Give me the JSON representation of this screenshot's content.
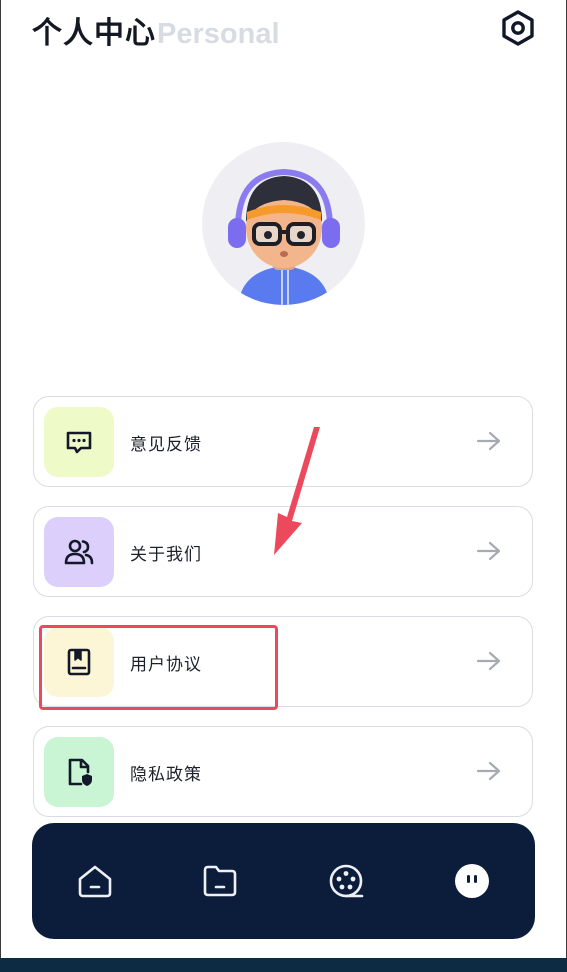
{
  "header": {
    "title": "个人中心",
    "subtitle": "Personal",
    "settings_icon": "gear-hex-icon"
  },
  "avatar": {
    "icon": "3d-character-headphones-avatar"
  },
  "menu": [
    {
      "label": "意见反馈",
      "icon": "message-dots-icon",
      "color": "#eefbc8"
    },
    {
      "label": "关于我们",
      "icon": "users-icon",
      "color": "#dccffb"
    },
    {
      "label": "用户协议",
      "icon": "document-bookmark-icon",
      "color": "#fdf6d6"
    },
    {
      "label": "隐私政策",
      "icon": "file-shield-icon",
      "color": "#c9f5d4"
    }
  ],
  "annotations": {
    "highlight_color": "#ec4a5c"
  },
  "tabbar": {
    "background": "#0c1d3b",
    "items": [
      {
        "icon": "home-icon"
      },
      {
        "icon": "folder-icon"
      },
      {
        "icon": "film-reel-icon"
      },
      {
        "icon": "profile-face-icon",
        "active": true
      }
    ]
  }
}
